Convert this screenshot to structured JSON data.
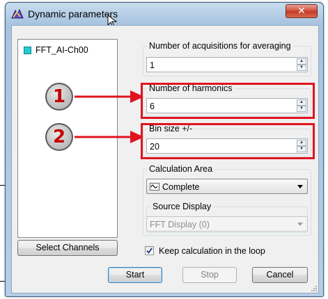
{
  "window": {
    "title": "Dynamic parameters",
    "close_icon": "close-x-icon",
    "app_icon": "app-window-icon"
  },
  "channels": {
    "items": [
      {
        "label": "FFT_AI-Ch00",
        "color": "#1ccfd6"
      }
    ],
    "select_button": "Select Channels"
  },
  "annotations": [
    {
      "number": "1",
      "color": "#e0141e"
    },
    {
      "number": "2",
      "color": "#e0141e"
    }
  ],
  "params": {
    "acquisitions_label": "Number of acquisitions for averaging",
    "acquisitions_value": "1",
    "harmonics_label": "Number of harmonics",
    "harmonics_value": "6",
    "bin_label": "Bin size +/-",
    "bin_value": "20"
  },
  "calculation": {
    "label": "Calculation Area",
    "selected": "Complete",
    "icon": "waveform-icon"
  },
  "source": {
    "label": "Source Display",
    "selected": "FFT Display (0)",
    "enabled": false
  },
  "keep_in_loop": {
    "label": "Keep calculation in the loop",
    "checked": true
  },
  "buttons": {
    "start": "Start",
    "stop": "Stop",
    "cancel": "Cancel"
  }
}
